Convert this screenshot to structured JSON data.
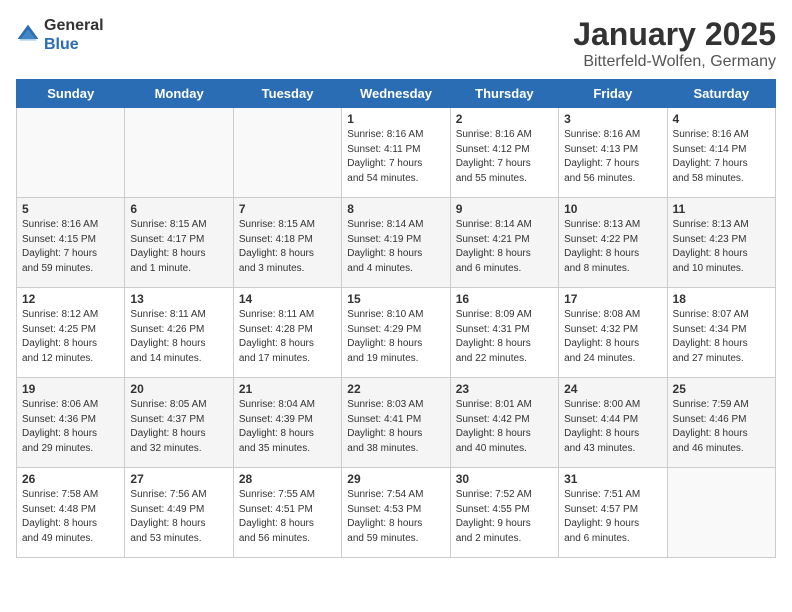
{
  "header": {
    "logo_general": "General",
    "logo_blue": "Blue",
    "month_title": "January 2025",
    "location": "Bitterfeld-Wolfen, Germany"
  },
  "weekdays": [
    "Sunday",
    "Monday",
    "Tuesday",
    "Wednesday",
    "Thursday",
    "Friday",
    "Saturday"
  ],
  "weeks": [
    [
      {
        "day": "",
        "info": ""
      },
      {
        "day": "",
        "info": ""
      },
      {
        "day": "",
        "info": ""
      },
      {
        "day": "1",
        "info": "Sunrise: 8:16 AM\nSunset: 4:11 PM\nDaylight: 7 hours\nand 54 minutes."
      },
      {
        "day": "2",
        "info": "Sunrise: 8:16 AM\nSunset: 4:12 PM\nDaylight: 7 hours\nand 55 minutes."
      },
      {
        "day": "3",
        "info": "Sunrise: 8:16 AM\nSunset: 4:13 PM\nDaylight: 7 hours\nand 56 minutes."
      },
      {
        "day": "4",
        "info": "Sunrise: 8:16 AM\nSunset: 4:14 PM\nDaylight: 7 hours\nand 58 minutes."
      }
    ],
    [
      {
        "day": "5",
        "info": "Sunrise: 8:16 AM\nSunset: 4:15 PM\nDaylight: 7 hours\nand 59 minutes."
      },
      {
        "day": "6",
        "info": "Sunrise: 8:15 AM\nSunset: 4:17 PM\nDaylight: 8 hours\nand 1 minute."
      },
      {
        "day": "7",
        "info": "Sunrise: 8:15 AM\nSunset: 4:18 PM\nDaylight: 8 hours\nand 3 minutes."
      },
      {
        "day": "8",
        "info": "Sunrise: 8:14 AM\nSunset: 4:19 PM\nDaylight: 8 hours\nand 4 minutes."
      },
      {
        "day": "9",
        "info": "Sunrise: 8:14 AM\nSunset: 4:21 PM\nDaylight: 8 hours\nand 6 minutes."
      },
      {
        "day": "10",
        "info": "Sunrise: 8:13 AM\nSunset: 4:22 PM\nDaylight: 8 hours\nand 8 minutes."
      },
      {
        "day": "11",
        "info": "Sunrise: 8:13 AM\nSunset: 4:23 PM\nDaylight: 8 hours\nand 10 minutes."
      }
    ],
    [
      {
        "day": "12",
        "info": "Sunrise: 8:12 AM\nSunset: 4:25 PM\nDaylight: 8 hours\nand 12 minutes."
      },
      {
        "day": "13",
        "info": "Sunrise: 8:11 AM\nSunset: 4:26 PM\nDaylight: 8 hours\nand 14 minutes."
      },
      {
        "day": "14",
        "info": "Sunrise: 8:11 AM\nSunset: 4:28 PM\nDaylight: 8 hours\nand 17 minutes."
      },
      {
        "day": "15",
        "info": "Sunrise: 8:10 AM\nSunset: 4:29 PM\nDaylight: 8 hours\nand 19 minutes."
      },
      {
        "day": "16",
        "info": "Sunrise: 8:09 AM\nSunset: 4:31 PM\nDaylight: 8 hours\nand 22 minutes."
      },
      {
        "day": "17",
        "info": "Sunrise: 8:08 AM\nSunset: 4:32 PM\nDaylight: 8 hours\nand 24 minutes."
      },
      {
        "day": "18",
        "info": "Sunrise: 8:07 AM\nSunset: 4:34 PM\nDaylight: 8 hours\nand 27 minutes."
      }
    ],
    [
      {
        "day": "19",
        "info": "Sunrise: 8:06 AM\nSunset: 4:36 PM\nDaylight: 8 hours\nand 29 minutes."
      },
      {
        "day": "20",
        "info": "Sunrise: 8:05 AM\nSunset: 4:37 PM\nDaylight: 8 hours\nand 32 minutes."
      },
      {
        "day": "21",
        "info": "Sunrise: 8:04 AM\nSunset: 4:39 PM\nDaylight: 8 hours\nand 35 minutes."
      },
      {
        "day": "22",
        "info": "Sunrise: 8:03 AM\nSunset: 4:41 PM\nDaylight: 8 hours\nand 38 minutes."
      },
      {
        "day": "23",
        "info": "Sunrise: 8:01 AM\nSunset: 4:42 PM\nDaylight: 8 hours\nand 40 minutes."
      },
      {
        "day": "24",
        "info": "Sunrise: 8:00 AM\nSunset: 4:44 PM\nDaylight: 8 hours\nand 43 minutes."
      },
      {
        "day": "25",
        "info": "Sunrise: 7:59 AM\nSunset: 4:46 PM\nDaylight: 8 hours\nand 46 minutes."
      }
    ],
    [
      {
        "day": "26",
        "info": "Sunrise: 7:58 AM\nSunset: 4:48 PM\nDaylight: 8 hours\nand 49 minutes."
      },
      {
        "day": "27",
        "info": "Sunrise: 7:56 AM\nSunset: 4:49 PM\nDaylight: 8 hours\nand 53 minutes."
      },
      {
        "day": "28",
        "info": "Sunrise: 7:55 AM\nSunset: 4:51 PM\nDaylight: 8 hours\nand 56 minutes."
      },
      {
        "day": "29",
        "info": "Sunrise: 7:54 AM\nSunset: 4:53 PM\nDaylight: 8 hours\nand 59 minutes."
      },
      {
        "day": "30",
        "info": "Sunrise: 7:52 AM\nSunset: 4:55 PM\nDaylight: 9 hours\nand 2 minutes."
      },
      {
        "day": "31",
        "info": "Sunrise: 7:51 AM\nSunset: 4:57 PM\nDaylight: 9 hours\nand 6 minutes."
      },
      {
        "day": "",
        "info": ""
      }
    ]
  ]
}
